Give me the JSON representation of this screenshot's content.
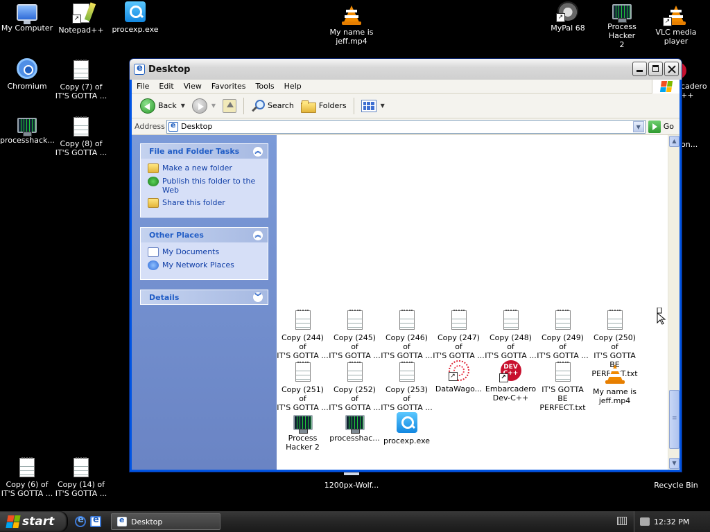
{
  "desktop": {
    "icons": [
      {
        "label": "My Computer"
      },
      {
        "label": "Notepad++"
      },
      {
        "label": "procexp.exe"
      },
      {
        "label": "My name is\njeff.mp4"
      },
      {
        "label": "MyPal 68"
      },
      {
        "label": "Process Hacker\n2"
      },
      {
        "label": "VLC media\nplayer"
      },
      {
        "label": "Chromium"
      },
      {
        "label": "Copy (7) of\nIT'S GOTTA ..."
      },
      {
        "label": "processhack..."
      },
      {
        "label": "Copy (8) of\nIT'S GOTTA ..."
      },
      {
        "label": "Copy (6) of\nIT'S GOTTA ..."
      },
      {
        "label": "Copy (14) of\nIT'S GOTTA ..."
      },
      {
        "label": "1200px-Wolf..."
      },
      {
        "label": "Recycle Bin"
      },
      {
        "label": "cadero\n++"
      },
      {
        "label": "on..."
      }
    ]
  },
  "window": {
    "title": "Desktop",
    "menu": [
      "File",
      "Edit",
      "View",
      "Favorites",
      "Tools",
      "Help"
    ],
    "toolbar": {
      "back": "Back",
      "search": "Search",
      "folders": "Folders"
    },
    "address": {
      "label": "Address",
      "value": "Desktop",
      "go": "Go"
    },
    "sidebar": {
      "file_tasks": {
        "title": "File and Folder Tasks",
        "items": [
          "Make a new folder",
          "Publish this folder to the Web",
          "Share this folder"
        ]
      },
      "other_places": {
        "title": "Other Places",
        "items": [
          "My Documents",
          "My Network Places"
        ]
      },
      "details": {
        "title": "Details"
      }
    },
    "files": [
      {
        "label": "Copy (244) of\nIT'S GOTTA ..."
      },
      {
        "label": "Copy (245) of\nIT'S GOTTA ..."
      },
      {
        "label": "Copy (246) of\nIT'S GOTTA ..."
      },
      {
        "label": "Copy (247) of\nIT'S GOTTA ..."
      },
      {
        "label": "Copy (248) of\nIT'S GOTTA ..."
      },
      {
        "label": "Copy (249) of\nIT'S GOTTA ..."
      },
      {
        "label": "Copy (250) of\nIT'S GOTTA BE\nPERFECT.txt"
      },
      {
        "label": "Copy (251) of\nIT'S GOTTA ..."
      },
      {
        "label": "Copy (252) of\nIT'S GOTTA ..."
      },
      {
        "label": "Copy (253) of\nIT'S GOTTA ..."
      },
      {
        "label": "DataWago..."
      },
      {
        "label": "Embarcadero\nDev-C++"
      },
      {
        "label": "IT'S GOTTA BE\nPERFECT.txt"
      },
      {
        "label": "My name is\njeff.mp4"
      },
      {
        "label": "Process\nHacker 2"
      },
      {
        "label": "processhac..."
      },
      {
        "label": "procexp.exe"
      }
    ]
  },
  "taskbar": {
    "start": "start",
    "task": "Desktop",
    "clock": "12:32 PM"
  },
  "devcpp_badge": "DEV\nC++",
  "colors": {
    "xp_red": "#f25022",
    "xp_green": "#7fba00",
    "xp_blue": "#00a4ef",
    "xp_yellow": "#ffb900"
  }
}
